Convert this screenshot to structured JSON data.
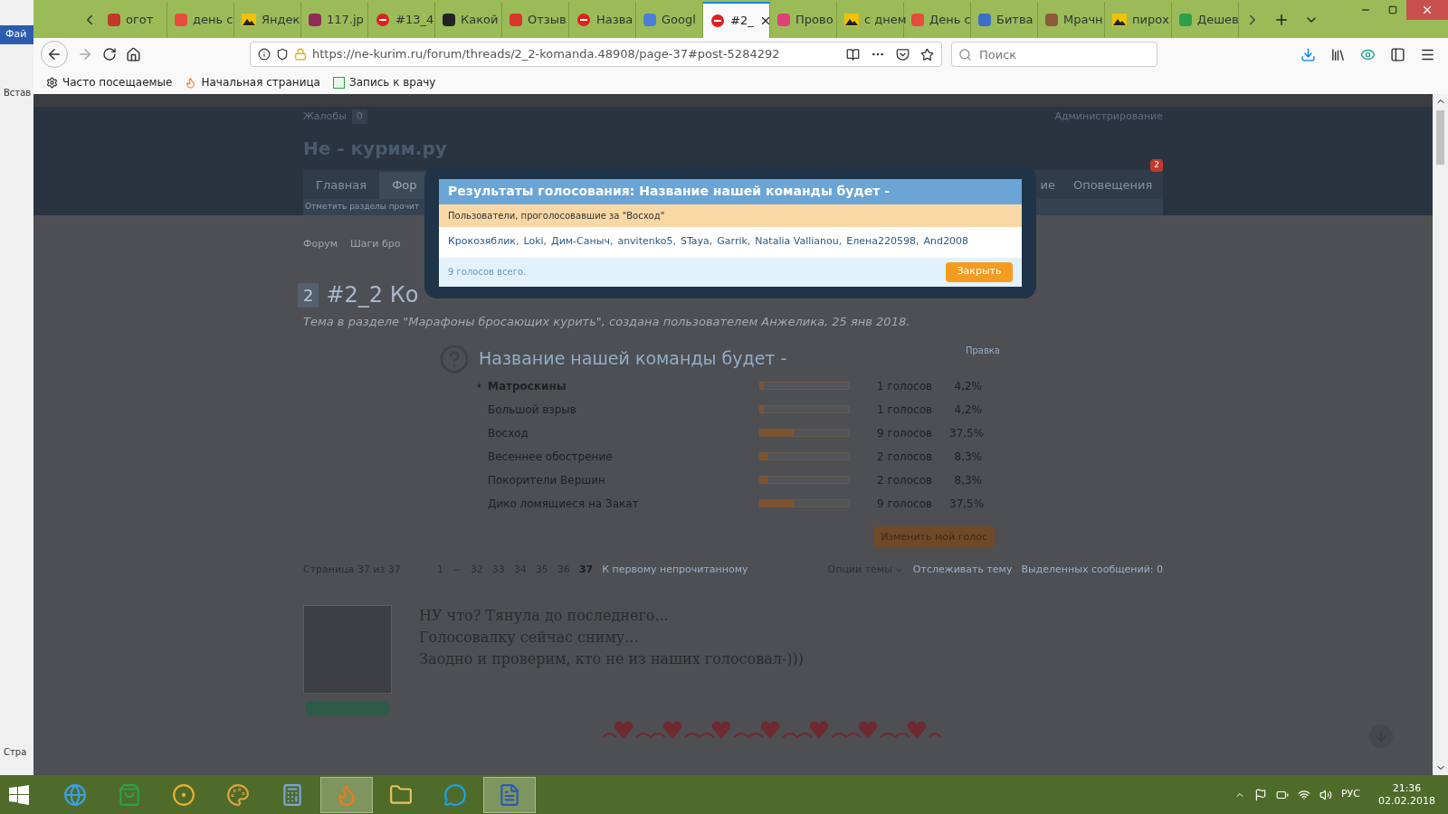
{
  "background_app": {
    "ribbon_tab": "Фай",
    "ribbon_button": "Встав",
    "status": "Стра"
  },
  "browser": {
    "tabs": [
      {
        "title": "огот",
        "kind": "site",
        "color": "#c0392b",
        "selected": false
      },
      {
        "title": "день с",
        "kind": "site",
        "color": "#e74c3c",
        "selected": false
      },
      {
        "title": "Яндек",
        "kind": "image",
        "selected": false
      },
      {
        "title": "117.jp",
        "kind": "site",
        "color": "#8e2b5a",
        "selected": false
      },
      {
        "title": "#13_4",
        "kind": "stop",
        "selected": false
      },
      {
        "title": "Какой",
        "kind": "site",
        "color": "#222222",
        "selected": false
      },
      {
        "title": "Отзыв",
        "kind": "site",
        "color": "#d9362b",
        "selected": false
      },
      {
        "title": "Назва",
        "kind": "stop",
        "selected": false
      },
      {
        "title": "Googl",
        "kind": "site",
        "color": "#4a7fd9",
        "selected": false
      },
      {
        "title": "#2_",
        "kind": "stop",
        "selected": true
      },
      {
        "title": "Прово",
        "kind": "site",
        "color": "#e0407a",
        "selected": false
      },
      {
        "title": "с днем",
        "kind": "image",
        "selected": false
      },
      {
        "title": "День с",
        "kind": "site",
        "color": "#e74c3c",
        "selected": false
      },
      {
        "title": "Битва",
        "kind": "site",
        "color": "#3a6fc4",
        "selected": false
      },
      {
        "title": "Мрачн",
        "kind": "site",
        "color": "#8a5a3a",
        "selected": false
      },
      {
        "title": "пирох",
        "kind": "image",
        "selected": false
      },
      {
        "title": "Дешев",
        "kind": "site",
        "color": "#2e9e4a",
        "selected": false
      }
    ],
    "address": "https://ne-kurim.ru/forum/threads/2_2-komanda.48908/page-37#post-5284292",
    "search": {
      "placeholder": "Поиск"
    },
    "bookmarks": [
      {
        "label": "Часто посещаемые",
        "kind": "gear"
      },
      {
        "label": "Начальная страница",
        "kind": "fox"
      },
      {
        "label": "Запись к врачу",
        "kind": "site"
      }
    ]
  },
  "page": {
    "top_bar": {
      "complaints": "Жалобы",
      "complaints_count": "0",
      "admin": "Администрирование"
    },
    "logo": "Не - курим.ру",
    "nav": [
      {
        "label": "Главная",
        "selected": false
      },
      {
        "label": "Фор",
        "selected": true
      }
    ],
    "nav_right": [
      {
        "label": "ие"
      },
      {
        "label": "Оповещения",
        "badge": "2"
      }
    ],
    "subnav": "Отметить разделы прочит",
    "breadcrumb": [
      "Форум",
      "Шаги бро"
    ],
    "thread_prefix": "2",
    "thread_title": "#2_2 Ко",
    "thread_meta": "Тема в разделе \"Марафоны бросающих курить\", создана пользователем Анжелика, 25 янв 2018.",
    "poll": {
      "title": "Название нашей команды будет -",
      "edit": "Правка",
      "options": [
        {
          "name": "Матроскины",
          "voted": true,
          "level": 0.042,
          "votes": "1 голосов",
          "percent": "4,2%"
        },
        {
          "name": "Большой взрыв",
          "voted": false,
          "level": 0.042,
          "votes": "1 голосов",
          "percent": "4,2%"
        },
        {
          "name": "Восход",
          "voted": false,
          "level": 0.375,
          "votes": "9 голосов",
          "percent": "37,5%"
        },
        {
          "name": "Весеннее обострение",
          "voted": false,
          "level": 0.083,
          "votes": "2 голосов",
          "percent": "8,3%"
        },
        {
          "name": "Покорители Вершин",
          "voted": false,
          "level": 0.083,
          "votes": "2 голосов",
          "percent": "8,3%"
        },
        {
          "name": "Дико ломящиеся на Закат",
          "voted": false,
          "level": 0.375,
          "votes": "9 голосов",
          "percent": "37,5%"
        }
      ],
      "change_button": "Изменить мой голос"
    },
    "pagination": {
      "label": "Страница 37 из 37",
      "first": "1",
      "pages": [
        {
          "label": "32",
          "selected": false
        },
        {
          "label": "33",
          "selected": false
        },
        {
          "label": "34",
          "selected": false
        },
        {
          "label": "35",
          "selected": false
        },
        {
          "label": "36",
          "selected": false
        },
        {
          "label": "37",
          "selected": true
        }
      ],
      "unread": "К первому непрочитанному",
      "options": "Опции темы",
      "watch": "Отслеживать тему",
      "selected_posts": "Выделенных сообщений: 0"
    },
    "post": {
      "lines": [
        "НУ что? Тянула до последнего...",
        "Голосовалку сейчас сниму...",
        "Заодно и проверим, кто не из наших голосовал-)))"
      ]
    }
  },
  "dialog": {
    "title": "Результаты голосования: Название нашей команды будет -",
    "subtitle": "Пользователи, проголосовавшие за \"Восход\"",
    "voters": [
      "Крокозяблик",
      "Loki",
      "Дим-Саныч",
      "anvitenko5",
      "STaya",
      "Garrik",
      "Natalia Vallianou",
      "Елена220598",
      "And2008"
    ],
    "separator": ",",
    "total": "9 голосов всего.",
    "close": "Закрыть"
  },
  "taskbar": {
    "apps": [
      {
        "kind": "globe",
        "selected": false
      },
      {
        "kind": "bag",
        "selected": false
      },
      {
        "kind": "circle",
        "selected": false
      },
      {
        "kind": "palette",
        "selected": false
      },
      {
        "kind": "calculator",
        "selected": false
      },
      {
        "kind": "flame",
        "selected": true
      },
      {
        "kind": "folder",
        "selected": false
      },
      {
        "kind": "chat",
        "selected": false
      },
      {
        "kind": "document",
        "selected": true
      }
    ],
    "language": "РУС",
    "time": "21:36",
    "date": "02.02.2018"
  }
}
